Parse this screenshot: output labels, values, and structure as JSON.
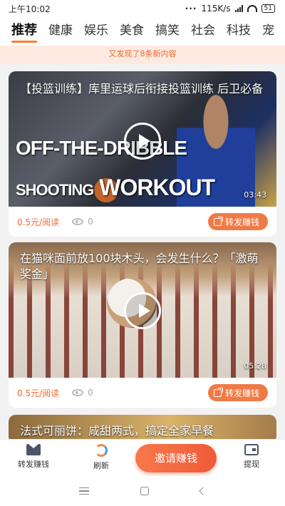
{
  "status_bar": {
    "time": "上午10:02",
    "dots": "···",
    "net_speed": "115K/s",
    "battery": "51"
  },
  "tabs": [
    {
      "label": "推荐",
      "active": true
    },
    {
      "label": "健康"
    },
    {
      "label": "娱乐"
    },
    {
      "label": "美食"
    },
    {
      "label": "搞笑"
    },
    {
      "label": "社会"
    },
    {
      "label": "科技"
    },
    {
      "label": "宠"
    }
  ],
  "notice": "又发现了8条新内容",
  "cards": [
    {
      "title": "【投篮训练】库里运球后衔接投篮训练 后卫必备",
      "thumb_text_1": "OFF-THE-DRIBBLE",
      "thumb_text_2a": "SHOOTING",
      "thumb_text_2b": "WORKOUT",
      "duration": "03:43",
      "price": "0.5元/阅读",
      "views": "0",
      "share_label": "转发赚钱"
    },
    {
      "title": "在猫咪面前放100块木头，会发生什么？「激萌奖金」",
      "duration": "05:28",
      "price": "0.5元/阅读",
      "views": "0",
      "share_label": "转发赚钱"
    },
    {
      "title": "法式可丽饼：咸甜两式，搞定全家早餐"
    }
  ],
  "bottom_nav": {
    "share": "转发赚钱",
    "refresh": "刷新",
    "invite": "邀请赚钱",
    "withdraw": "提现"
  },
  "colors": {
    "accent": "#f07a45",
    "notice_bg": "#fde9e0",
    "notice_text": "#ef6a2e"
  }
}
